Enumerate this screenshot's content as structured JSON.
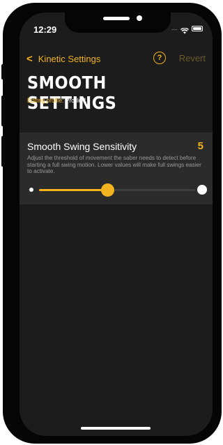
{
  "status": {
    "time": "12:29",
    "signal": "....",
    "wifi_icon": "wifi-icon",
    "battery_icon": "battery-icon"
  },
  "nav": {
    "back_label": "Kinetic Settings",
    "help_icon": "question-circle-icon",
    "help_glyph": "?",
    "revert_label": "Revert"
  },
  "page": {
    "title": "SMOOTH SETTINGS",
    "profile_label": "Editing profile:",
    "profile_value": "Profile 1"
  },
  "setting": {
    "title": "Smooth Swing Sensitivity",
    "value": "5",
    "description": "Adjust the threshold of movement the saber needs to detect before starting a full swing motion. Lower values will make full swings easier to activate.",
    "slider_fraction": 0.44
  },
  "colors": {
    "accent": "#f2b31e",
    "background": "#1c1c1c",
    "card": "#2b2b2b"
  }
}
